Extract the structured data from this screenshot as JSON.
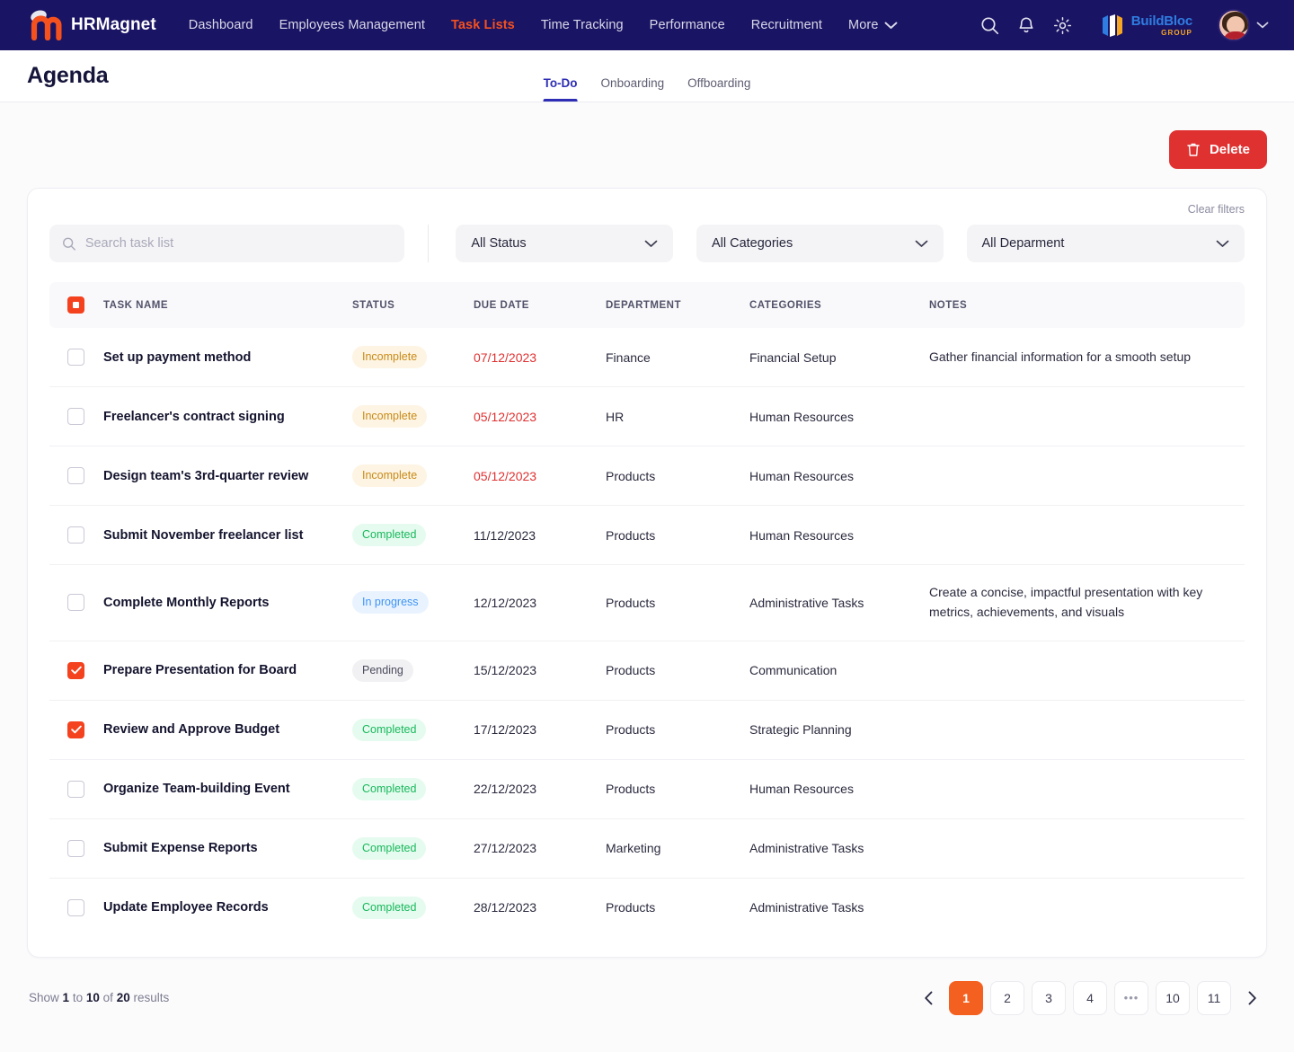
{
  "brand": {
    "name": "HRMagnet",
    "logo_icon": "magnet-m-logo"
  },
  "nav": {
    "items": [
      {
        "label": "Dashboard",
        "active": false
      },
      {
        "label": "Employees Management",
        "active": false
      },
      {
        "label": "Task Lists",
        "active": true
      },
      {
        "label": "Time Tracking",
        "active": false
      },
      {
        "label": "Performance",
        "active": false
      },
      {
        "label": "Recruitment",
        "active": false
      }
    ],
    "more_label": "More",
    "icons": [
      "search-icon",
      "notification-bell-icon",
      "gear-icon"
    ],
    "company": {
      "name": "BuildBloc",
      "sub": "GROUP"
    }
  },
  "header": {
    "title": "Agenda",
    "tabs": [
      {
        "label": "To-Do",
        "active": true
      },
      {
        "label": "Onboarding",
        "active": false
      },
      {
        "label": "Offboarding",
        "active": false
      }
    ]
  },
  "toolbar": {
    "delete_label": "Delete"
  },
  "filters": {
    "clear_label": "Clear filters",
    "search_placeholder": "Search task list",
    "search_value": "",
    "status": "All Status",
    "categories": "All Categories",
    "department": "All Deparment"
  },
  "table": {
    "columns": [
      "TASK NAME",
      "STATUS",
      "DUE DATE",
      "DEPARTMENT",
      "CATEGORIES",
      "NOTES"
    ],
    "select_all_state": "indeterminate",
    "rows": [
      {
        "checked": false,
        "task": "Set up payment method",
        "status": "Incomplete",
        "status_kind": "incomplete",
        "due": "07/12/2023",
        "overdue": true,
        "department": "Finance",
        "category": "Financial Setup",
        "notes": "Gather financial information for a smooth setup"
      },
      {
        "checked": false,
        "task": "Freelancer's contract signing",
        "status": "Incomplete",
        "status_kind": "incomplete",
        "due": "05/12/2023",
        "overdue": true,
        "department": "HR",
        "category": "Human Resources",
        "notes": ""
      },
      {
        "checked": false,
        "task": "Design team's 3rd-quarter review",
        "status": "Incomplete",
        "status_kind": "incomplete",
        "due": "05/12/2023",
        "overdue": true,
        "department": "Products",
        "category": "Human Resources",
        "notes": ""
      },
      {
        "checked": false,
        "task": "Submit November freelancer list",
        "status": "Completed",
        "status_kind": "completed",
        "due": "11/12/2023",
        "overdue": false,
        "department": "Products",
        "category": "Human Resources",
        "notes": ""
      },
      {
        "checked": false,
        "task": "Complete Monthly Reports",
        "status": "In progress",
        "status_kind": "inprogress",
        "due": "12/12/2023",
        "overdue": false,
        "department": "Products",
        "category": "Administrative Tasks",
        "notes": "Create a concise, impactful presentation with key metrics, achievements, and visuals"
      },
      {
        "checked": true,
        "task": "Prepare Presentation for Board",
        "status": "Pending",
        "status_kind": "pending",
        "due": "15/12/2023",
        "overdue": false,
        "department": "Products",
        "category": "Communication",
        "notes": ""
      },
      {
        "checked": true,
        "task": "Review and Approve Budget",
        "status": "Completed",
        "status_kind": "completed",
        "due": "17/12/2023",
        "overdue": false,
        "department": "Products",
        "category": "Strategic Planning",
        "notes": ""
      },
      {
        "checked": false,
        "task": "Organize Team-building Event",
        "status": "Completed",
        "status_kind": "completed",
        "due": "22/12/2023",
        "overdue": false,
        "department": "Products",
        "category": "Human Resources",
        "notes": ""
      },
      {
        "checked": false,
        "task": "Submit Expense Reports",
        "status": "Completed",
        "status_kind": "completed",
        "due": "27/12/2023",
        "overdue": false,
        "department": "Marketing",
        "category": "Administrative Tasks",
        "notes": ""
      },
      {
        "checked": false,
        "task": "Update Employee Records",
        "status": "Completed",
        "status_kind": "completed",
        "due": "28/12/2023",
        "overdue": false,
        "department": "Products",
        "category": "Administrative Tasks",
        "notes": ""
      }
    ]
  },
  "footer": {
    "results_prefix": "Show",
    "results_from": "1",
    "results_mid": "to",
    "results_to": "10",
    "results_of": "of",
    "results_total": "20",
    "results_suffix": "results",
    "pages": [
      "1",
      "2",
      "3",
      "4",
      "•••",
      "10",
      "11"
    ],
    "active_page": "1"
  },
  "colors": {
    "nav_bg": "#1a1464",
    "accent_orange": "#f4511e",
    "checkbox_orange": "#f4421f",
    "danger_red": "#e03131",
    "tab_blue": "#2d2db5",
    "page_active": "#f4601f"
  }
}
